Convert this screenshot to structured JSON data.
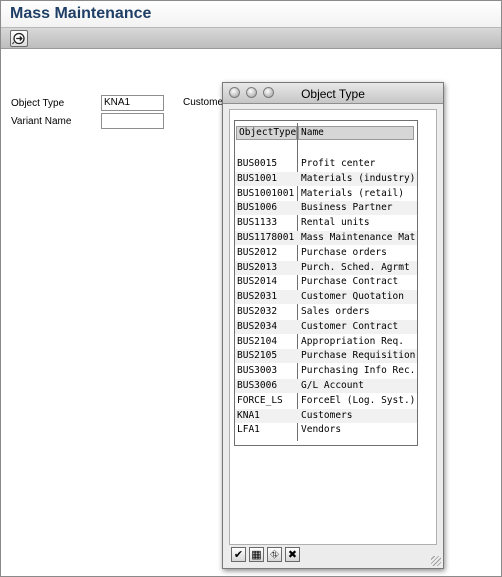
{
  "page": {
    "title": "Mass Maintenance"
  },
  "toolbar": {
    "execute_icon": "execute-icon"
  },
  "form": {
    "object_type_label": "Object Type",
    "object_type_value": "KNA1",
    "variant_name_label": "Variant Name",
    "variant_name_value": "",
    "customer_text": "Customer"
  },
  "dialog": {
    "title": "Object Type",
    "columns": [
      "ObjectType",
      "Name"
    ],
    "rows": [
      {
        "key": "BUS0015",
        "name": "Profit center"
      },
      {
        "key": "BUS1001",
        "name": "Materials (industry)"
      },
      {
        "key": "BUS1001001",
        "name": "Materials (retail)"
      },
      {
        "key": "BUS1006",
        "name": "Business Partner"
      },
      {
        "key": "BUS1133",
        "name": "Rental units"
      },
      {
        "key": "BUS1178001",
        "name": "Mass Maintenance Mat"
      },
      {
        "key": "BUS2012",
        "name": "Purchase orders"
      },
      {
        "key": "BUS2013",
        "name": "Purch. Sched. Agrmt"
      },
      {
        "key": "BUS2014",
        "name": "Purchase Contract"
      },
      {
        "key": "BUS2031",
        "name": "Customer Quotation"
      },
      {
        "key": "BUS2032",
        "name": "Sales orders"
      },
      {
        "key": "BUS2034",
        "name": "Customer Contract"
      },
      {
        "key": "BUS2104",
        "name": "Appropriation Req."
      },
      {
        "key": "BUS2105",
        "name": "Purchase Requisition"
      },
      {
        "key": "BUS3003",
        "name": "Purchasing Info Rec."
      },
      {
        "key": "BUS3006",
        "name": "G/L Account"
      },
      {
        "key": "FORCE_LS",
        "name": "ForceEl (Log. Syst.)"
      },
      {
        "key": "KNA1",
        "name": "Customers"
      },
      {
        "key": "LFA1",
        "name": "Vendors"
      }
    ],
    "footer_buttons": [
      {
        "icon": "checkmark-icon",
        "glyph": "✔"
      },
      {
        "icon": "find-icon",
        "glyph": "▦"
      },
      {
        "icon": "binoculars-icon",
        "glyph": "⛗"
      },
      {
        "icon": "cancel-icon",
        "glyph": "✖"
      }
    ]
  }
}
